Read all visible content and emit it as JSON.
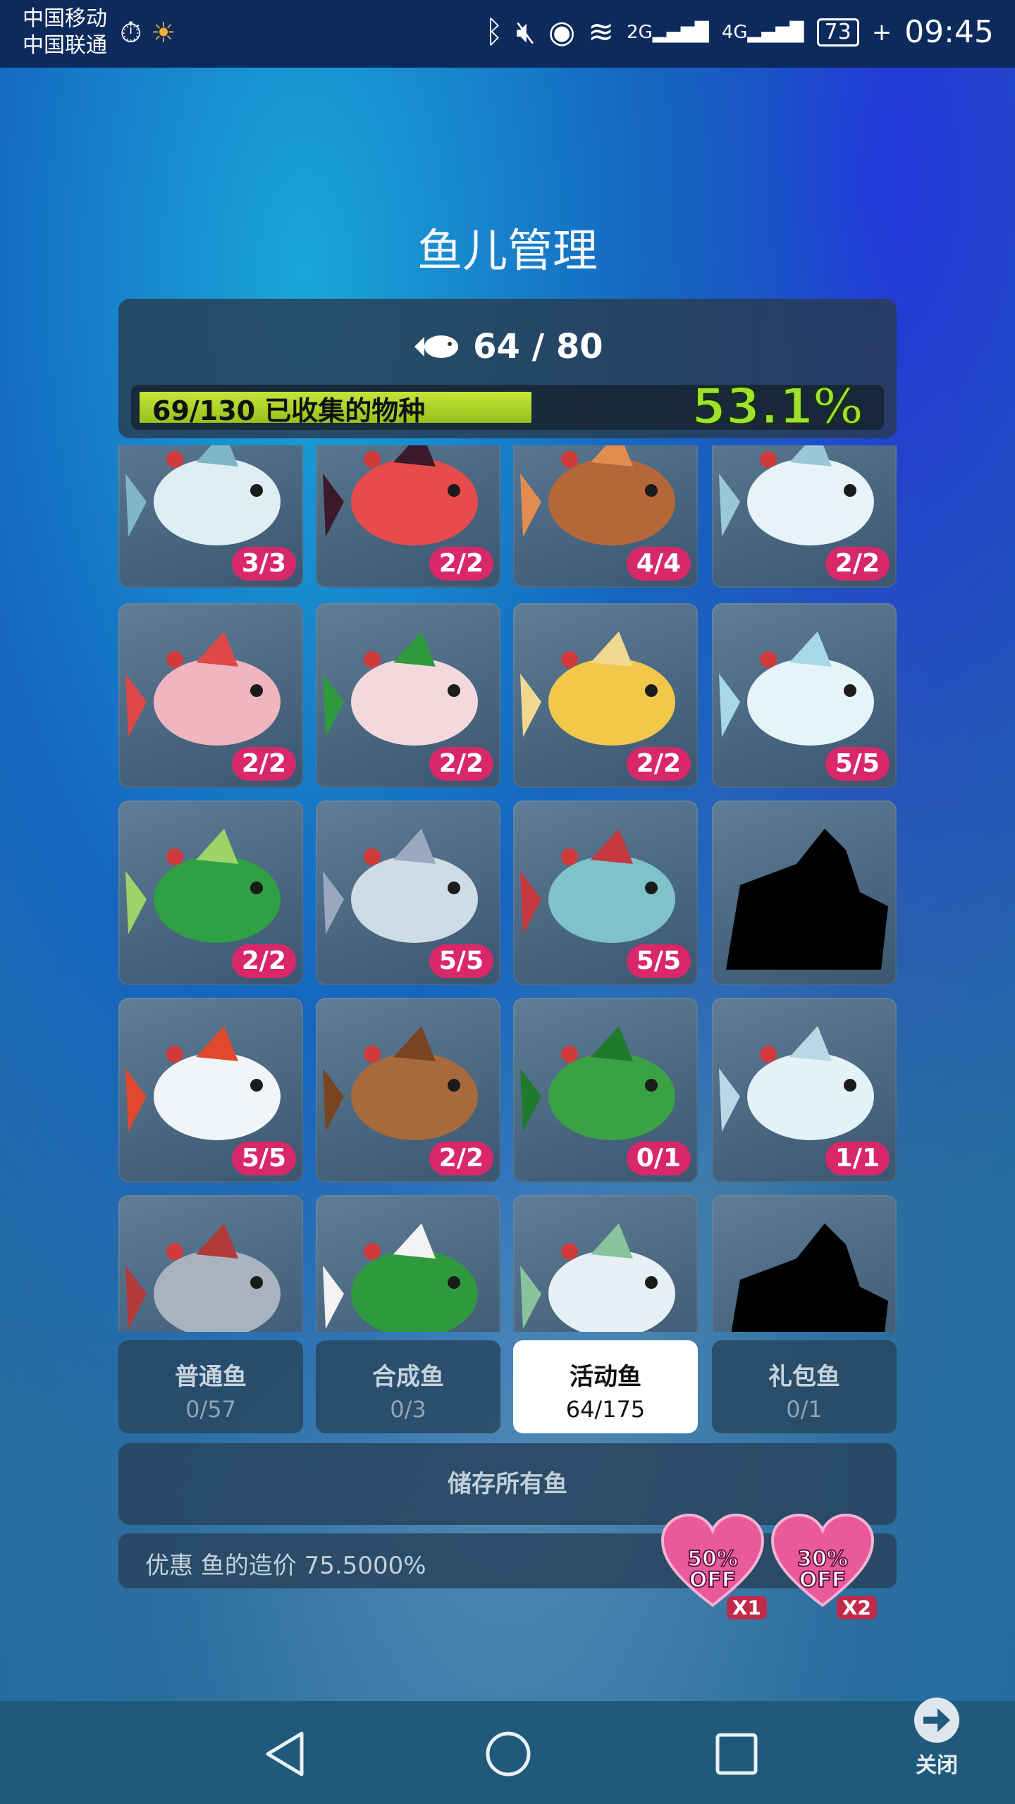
{
  "status_bar": {
    "carrier1": "中国移动",
    "carrier2": "中国联通",
    "battery": "73",
    "time": "09:45",
    "net1": "2G",
    "net2": "4G"
  },
  "title": "鱼儿管理",
  "summary": {
    "fish_count": "64 / 80",
    "species_label": "69/130 已收集的物种",
    "percent": "53.1%",
    "progress_fraction": 0.531
  },
  "fish": [
    {
      "count": "3/3",
      "kind": "snow-dugong"
    },
    {
      "count": "2/2",
      "kind": "clownfish"
    },
    {
      "count": "4/4",
      "kind": "reindeer-fish"
    },
    {
      "count": "2/2",
      "kind": "snow-bunny"
    },
    {
      "count": "2/2",
      "kind": "stocking-pig"
    },
    {
      "count": "2/2",
      "kind": "holly-seadragon"
    },
    {
      "count": "2/2",
      "kind": "bell-squid"
    },
    {
      "count": "5/5",
      "kind": "snowflake-whale"
    },
    {
      "count": "2/2",
      "kind": "holly-swordfish"
    },
    {
      "count": "5/5",
      "kind": "snow-jellyfish"
    },
    {
      "count": "5/5",
      "kind": "snowglobe-turtle"
    },
    {
      "count": "",
      "kind": "silhouette-reindeer"
    },
    {
      "count": "5/5",
      "kind": "snowman-narwhal"
    },
    {
      "count": "2/2",
      "kind": "gingerbread-ray"
    },
    {
      "count": "0/1",
      "kind": "holly-shark"
    },
    {
      "count": "1/1",
      "kind": "snowy-tree-whale"
    },
    {
      "count": "",
      "kind": "top-hat-shark"
    },
    {
      "count": "",
      "kind": "kelp-eel"
    },
    {
      "count": "",
      "kind": "snow-walrus"
    },
    {
      "count": "",
      "kind": "silhouette-ship"
    }
  ],
  "tabs": [
    {
      "label": "普通鱼",
      "count": "0/57"
    },
    {
      "label": "合成鱼",
      "count": "0/3"
    },
    {
      "label": "活动鱼",
      "count": "64/175"
    },
    {
      "label": "礼包鱼",
      "count": "0/1"
    }
  ],
  "store_button": "储存所有鱼",
  "discount_text": "优惠 鱼的造价 75.5000%",
  "coupons": [
    {
      "text": "50%\nOFF",
      "top": "50%",
      "bottom": "OFF",
      "mult": "X1"
    },
    {
      "text": "30%\nOFF",
      "top": "30%",
      "bottom": "OFF",
      "mult": "X2"
    }
  ],
  "close_label": "关闭",
  "colors": {
    "badge": "#d8286a",
    "progress": "#b5d82c",
    "percent": "#9ee22b"
  }
}
